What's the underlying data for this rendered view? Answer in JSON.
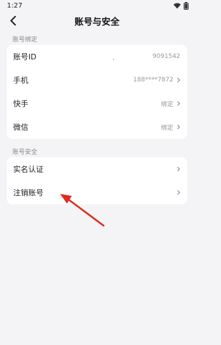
{
  "status": {
    "time": "1:27"
  },
  "header": {
    "title": "账号与安全"
  },
  "sections": [
    {
      "title": "账号绑定",
      "items": [
        {
          "label": "账号ID",
          "value": "9091542"
        },
        {
          "label": "手机",
          "value": "188****7872"
        },
        {
          "label": "快手",
          "value": "绑定"
        },
        {
          "label": "微信",
          "value": "绑定"
        }
      ]
    },
    {
      "title": "账号安全",
      "items": [
        {
          "label": "实名认证",
          "value": ""
        },
        {
          "label": "注销账号",
          "value": ""
        }
      ]
    }
  ],
  "stray_mark": "·",
  "colors": {
    "annotation_arrow": "#e02a1f",
    "background": "#f4f4f6"
  },
  "icons": [
    "back-arrow-icon",
    "wifi-icon",
    "battery-icon",
    "chevron-right-icon"
  ]
}
